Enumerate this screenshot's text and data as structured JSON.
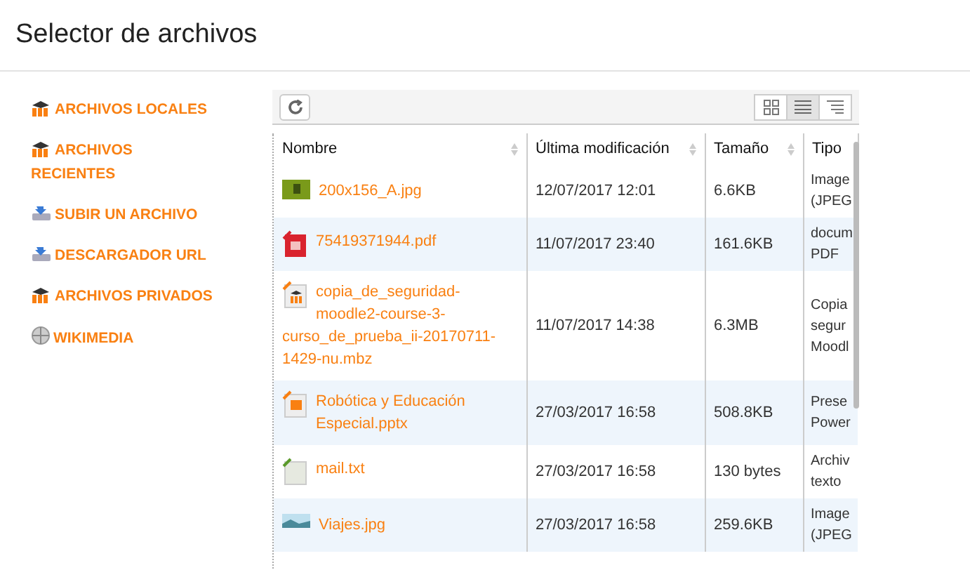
{
  "window": {
    "title": "Selector de archivos"
  },
  "sidebar": {
    "items": [
      {
        "label": "ARCHIVOS LOCALES",
        "kind": "moodle"
      },
      {
        "label": "ARCHIVOS RECIENTES",
        "kind": "moodle"
      },
      {
        "label": "SUBIR UN ARCHIVO",
        "kind": "upload"
      },
      {
        "label": "DESCARGADOR URL",
        "kind": "upload"
      },
      {
        "label": "ARCHIVOS PRIVADOS",
        "kind": "moodle"
      },
      {
        "label": "WIKIMEDIA",
        "kind": "wiki"
      }
    ]
  },
  "toolbar": {
    "view_buttons": [
      {
        "kind": "icons",
        "selected": false
      },
      {
        "kind": "list",
        "selected": true
      },
      {
        "kind": "tree",
        "selected": false
      }
    ]
  },
  "table": {
    "columns": [
      "Nombre",
      "Última modificación",
      "Tamaño",
      "Tipo"
    ],
    "rows": [
      {
        "kind": "image",
        "name": "200x156_A.jpg",
        "modified": "12/07/2017 12:01",
        "size": "6.6KB",
        "type": [
          "Image",
          "(JPEG"
        ]
      },
      {
        "kind": "pdf",
        "name": "75419371944.pdf",
        "modified": "11/07/2017 23:40",
        "size": "161.6KB",
        "type": [
          "docum",
          "PDF"
        ]
      },
      {
        "kind": "moodle",
        "name": "copia_de_seguridad-moodle2-course-3-curso_de_prueba_ii-20170711-1429-nu.mbz",
        "modified": "11/07/2017 14:38",
        "size": "6.3MB",
        "type": [
          "Copia",
          "segur",
          "Moodl"
        ]
      },
      {
        "kind": "pptx",
        "name": "Robótica y Educación Especial.pptx",
        "modified": "27/03/2017 16:58",
        "size": "508.8KB",
        "type": [
          "Prese",
          "Power"
        ]
      },
      {
        "kind": "text",
        "name": "mail.txt",
        "modified": "27/03/2017 16:58",
        "size": "130 bytes",
        "type": [
          "Archiv",
          "texto"
        ]
      },
      {
        "kind": "photo",
        "name": "Viajes.jpg",
        "modified": "27/03/2017 16:58",
        "size": "259.6KB",
        "type": [
          "Image",
          "(JPEG"
        ]
      }
    ]
  }
}
